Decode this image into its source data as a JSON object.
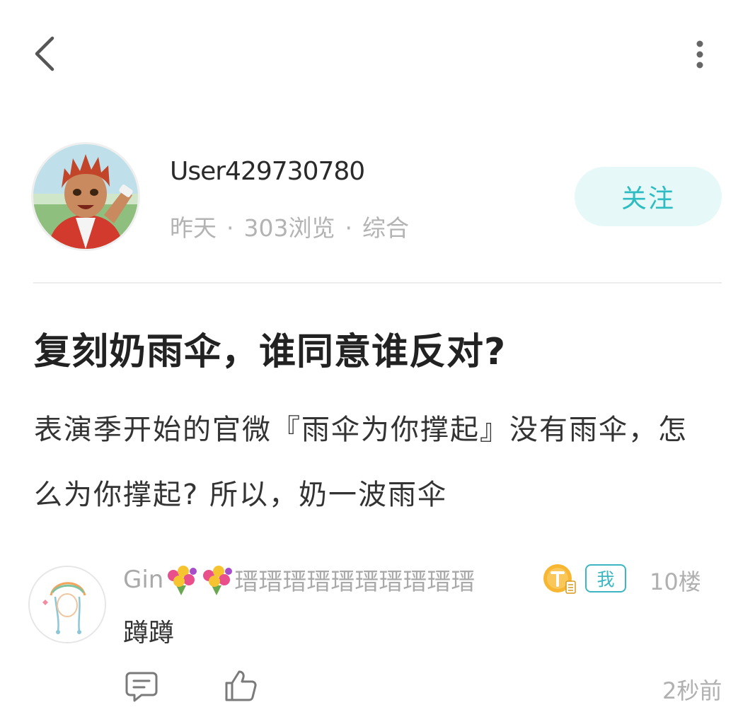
{
  "topbar": {
    "back_icon": "chevron-left-icon",
    "more_icon": "more-vertical-icon"
  },
  "author": {
    "name": "User429730780",
    "date": "昨天",
    "views": "303浏览",
    "category": "综合",
    "separator": "·",
    "follow_label": "关注"
  },
  "post": {
    "title": "复刻奶雨伞，谁同意谁反对?",
    "body": "表演季开始的官微『雨伞为你撑起』没有雨伞，怎么为你撑起? 所以，奶一波雨伞"
  },
  "comment": {
    "name_prefix": "Gin",
    "name_suffix": "瑨瑨瑨瑨瑨瑨瑨瑨瑨瑨",
    "me_badge": "我",
    "floor": "10楼",
    "text": "蹲蹲",
    "time": "2秒前",
    "reply_icon": "comment-icon",
    "like_icon": "thumbs-up-icon"
  },
  "colors": {
    "accent": "#2cbcc2",
    "follow_bg": "#e7f8f8",
    "muted": "#b3b3b3"
  }
}
